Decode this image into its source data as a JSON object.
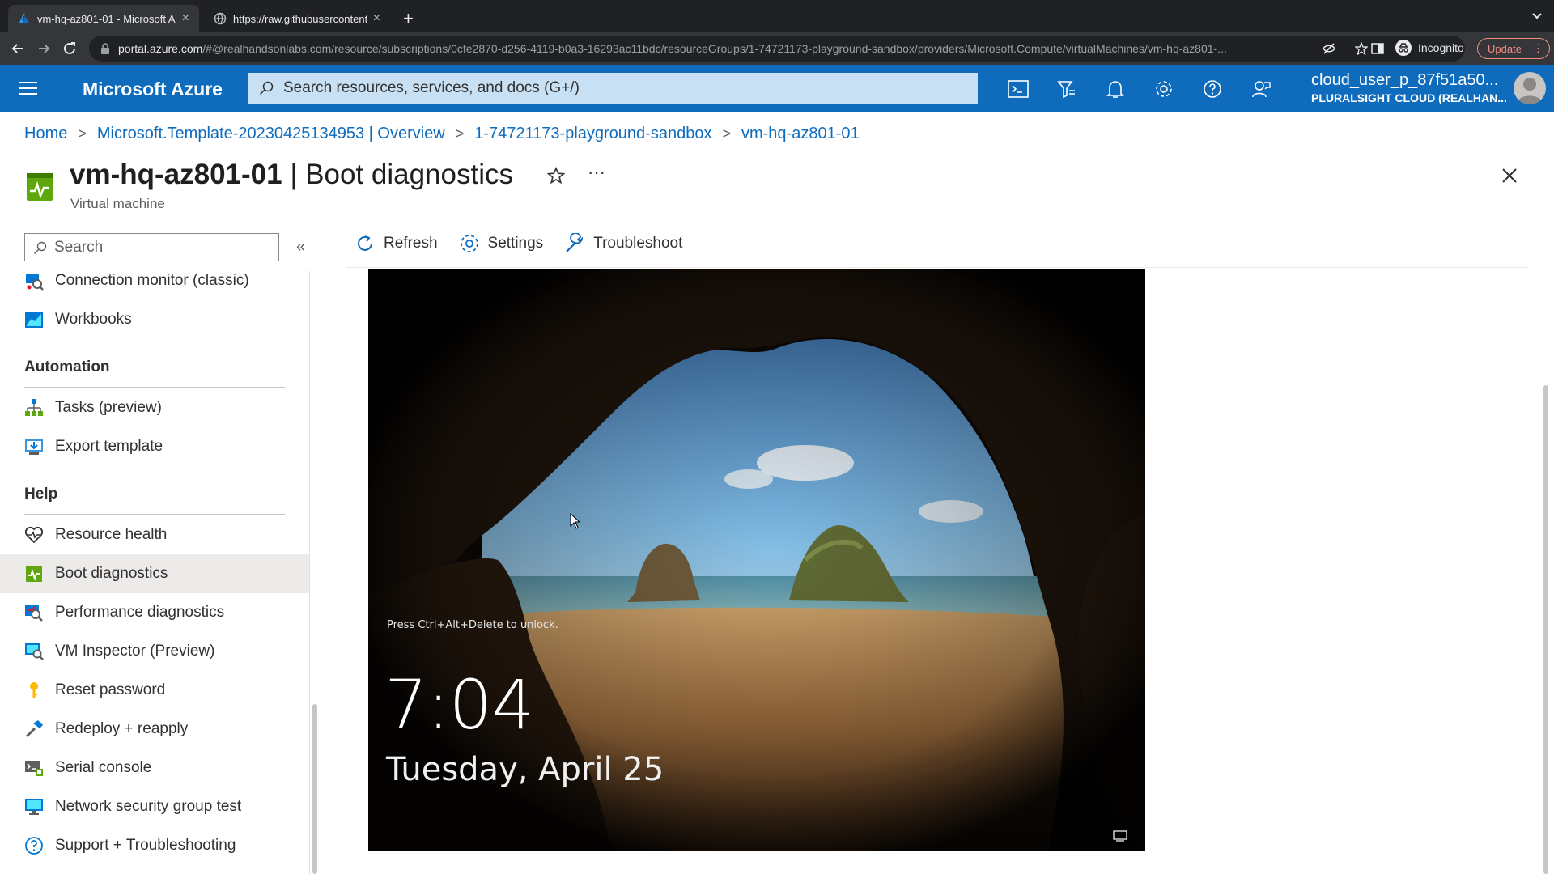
{
  "browser": {
    "tabs": [
      {
        "title": "vm-hq-az801-01 - Microsoft A",
        "active": true
      },
      {
        "title": "https://raw.githubusercontent.",
        "active": false
      }
    ],
    "url_host": "portal.azure.com",
    "url_path": "/#@realhandsonlabs.com/resource/subscriptions/0cfe2870-d256-4119-b0a3-16293ac11bdc/resourceGroups/1-74721173-playground-sandbox/providers/Microsoft.Compute/virtualMachines/vm-hq-az801-...",
    "incognito_label": "Incognito",
    "update_label": "Update"
  },
  "azure": {
    "brand": "Microsoft Azure",
    "search_placeholder": "Search resources, services, and docs (G+/)",
    "user_name": "cloud_user_p_87f51a50...",
    "user_tenant": "PLURALSIGHT CLOUD (REALHAN..."
  },
  "breadcrumb": [
    "Home",
    "Microsoft.Template-20230425134953 | Overview",
    "1-74721173-playground-sandbox",
    "vm-hq-az801-01"
  ],
  "page": {
    "title_resource": "vm-hq-az801-01",
    "title_sep": " | ",
    "title_blade": "Boot diagnostics",
    "subtitle": "Virtual machine",
    "more": "···"
  },
  "leftnav": {
    "search_placeholder": "Search",
    "collapse": "«",
    "items_top": [
      {
        "label": "Connection monitor (classic)",
        "icon": "connection-monitor-icon"
      },
      {
        "label": "Workbooks",
        "icon": "workbooks-icon"
      }
    ],
    "section_automation": "Automation",
    "items_automation": [
      {
        "label": "Tasks (preview)",
        "icon": "tasks-icon"
      },
      {
        "label": "Export template",
        "icon": "export-template-icon"
      }
    ],
    "section_help": "Help",
    "items_help": [
      {
        "label": "Resource health",
        "icon": "heart-icon"
      },
      {
        "label": "Boot diagnostics",
        "icon": "boot-diagnostics-icon",
        "selected": true
      },
      {
        "label": "Performance diagnostics",
        "icon": "performance-diagnostics-icon"
      },
      {
        "label": "VM Inspector (Preview)",
        "icon": "vm-inspector-icon"
      },
      {
        "label": "Reset password",
        "icon": "key-icon"
      },
      {
        "label": "Redeploy + reapply",
        "icon": "hammer-icon"
      },
      {
        "label": "Serial console",
        "icon": "serial-console-icon"
      },
      {
        "label": "Network security group test",
        "icon": "monitor-icon"
      },
      {
        "label": "Support + Troubleshooting",
        "icon": "question-icon"
      }
    ]
  },
  "commands": {
    "refresh": "Refresh",
    "settings": "Settings",
    "troubleshoot": "Troubleshoot"
  },
  "screenshot": {
    "unlock_hint": "Press Ctrl+Alt+Delete to unlock.",
    "time": "7:04",
    "date": "Tuesday, April 25"
  },
  "colors": {
    "azure_blue": "#0f6cbd",
    "link": "#0f6cbd",
    "selected_nav": "#edebe9"
  }
}
